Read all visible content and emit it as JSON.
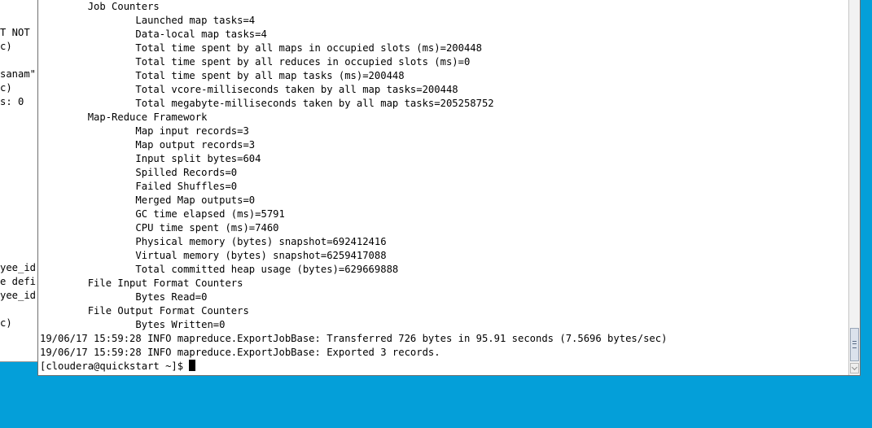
{
  "background_window": {
    "lines": [
      "",
      "",
      "T NOT",
      "c)",
      "",
      "sanam\"",
      "c)",
      "s: 0",
      "",
      "",
      "",
      "",
      "",
      "",
      "",
      "",
      "",
      "",
      "",
      "yee_id",
      "e defi",
      "yee_id",
      "",
      "c)"
    ]
  },
  "terminal": {
    "lines": [
      "        Job Counters",
      "                Launched map tasks=4",
      "                Data-local map tasks=4",
      "                Total time spent by all maps in occupied slots (ms)=200448",
      "                Total time spent by all reduces in occupied slots (ms)=0",
      "                Total time spent by all map tasks (ms)=200448",
      "                Total vcore-milliseconds taken by all map tasks=200448",
      "                Total megabyte-milliseconds taken by all map tasks=205258752",
      "        Map-Reduce Framework",
      "                Map input records=3",
      "                Map output records=3",
      "                Input split bytes=604",
      "                Spilled Records=0",
      "                Failed Shuffles=0",
      "                Merged Map outputs=0",
      "                GC time elapsed (ms)=5791",
      "                CPU time spent (ms)=7460",
      "                Physical memory (bytes) snapshot=692412416",
      "                Virtual memory (bytes) snapshot=6259417088",
      "                Total committed heap usage (bytes)=629669888",
      "        File Input Format Counters",
      "                Bytes Read=0",
      "        File Output Format Counters",
      "                Bytes Written=0",
      "19/06/17 15:59:28 INFO mapreduce.ExportJobBase: Transferred 726 bytes in 95.91 seconds (7.5696 bytes/sec)",
      "19/06/17 15:59:28 INFO mapreduce.ExportJobBase: Exported 3 records."
    ],
    "prompt": "[cloudera@quickstart ~]$ "
  },
  "scrollbar": {
    "position_fraction": 1.0
  },
  "colors": {
    "desktop": "#049fd9",
    "terminal_bg": "#ffffff",
    "text": "#000000"
  },
  "icons": [
    "grip-icon",
    "chevron-down-icon"
  ]
}
